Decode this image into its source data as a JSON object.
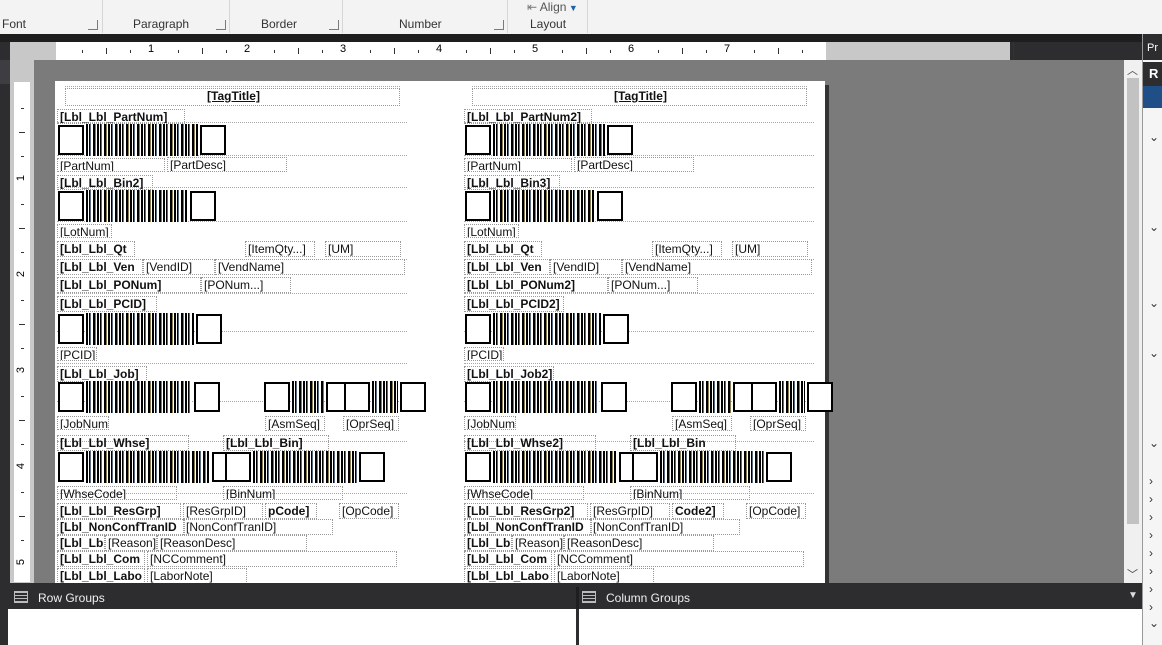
{
  "ribbon": {
    "groups": [
      "Font",
      "Paragraph",
      "Border",
      "Number",
      "Layout"
    ],
    "align_label": "Align"
  },
  "ruler": {
    "h_numbers": [
      "1",
      "2",
      "3",
      "4",
      "5",
      "6",
      "7"
    ],
    "v_numbers": [
      "1",
      "2",
      "3",
      "4",
      "5"
    ]
  },
  "report": {
    "left": {
      "tag_title": "[TagTitle]",
      "part_num_label": "[Lbl_Lbl_PartNum]",
      "part_num": "[PartNum]",
      "part_desc": "[PartDesc]",
      "bin_label": "[Lbl_Lbl_Bin2]",
      "lot_num": "[LotNum]",
      "qty_label": "[Lbl_Lbl_Qt",
      "item_qty": "[ItemQty...]",
      "um": "[UM]",
      "vend_label": "[Lbl_Lbl_Ven",
      "vend_id": "[VendID]",
      "vend_name": "[VendName]",
      "ponum_label": "[Lbl_Lbl_PONum]",
      "ponum": "[PONum...]",
      "pcid_label": "[Lbl_Lbl_PCID]",
      "pcid": "[PCID]",
      "job_label": "[Lbl_Lbl_Job]",
      "job_num": "[JobNum]",
      "asm_seq": "[AsmSeq]",
      "opr_seq": "[OprSeq]",
      "whse_label": "[Lbl_Lbl_Whse]",
      "bin2_label": "[Lbl_Lbl_Bin]",
      "whse_code": "[WhseCode]",
      "bin_num": "[BinNum]",
      "resgrp_label": "[Lbl_Lbl_ResGrp]",
      "resgrp_id": "[ResGrpID]",
      "pcode": "pCode]",
      "opcode": "[OpCode]",
      "nonconf_label": "[Lbl_NonConfTranID",
      "nonconf_id": "[NonConfTranID]",
      "reason_label": "[Lbl_Lbl",
      "reason": "[Reason]",
      "reason_desc": "[ReasonDesc]",
      "comment_label": "[Lbl_Lbl_Com",
      "nc_comment": "[NCComment]",
      "labor_label": "[Lbl_Lbl_Labo",
      "labor_note": "[LaborNote]"
    },
    "right": {
      "tag_title": "[TagTitle]",
      "part_num_label": "[Lbl_Lbl_PartNum2]",
      "part_num": "[PartNum]",
      "part_desc": "[PartDesc]",
      "bin_label": "[Lbl_Lbl_Bin3]",
      "lot_num": "[LotNum]",
      "qty_label": "[Lbl_Lbl_Qt",
      "item_qty": "[ItemQty...]",
      "um": "[UM]",
      "vend_label": "[Lbl_Lbl_Ven",
      "vend_id": "[VendID]",
      "vend_name": "[VendName]",
      "ponum_label": "[Lbl_Lbl_PONum2]",
      "ponum": "[PONum...]",
      "pcid_label": "[Lbl_Lbl_PCID2]",
      "pcid": "[PCID]",
      "job_label": "[Lbl_Lbl_Job2]",
      "job_num": "[JobNum]",
      "asm_seq": "[AsmSeq]",
      "opr_seq": "[OprSeq]",
      "whse_label": "[Lbl_Lbl_Whse2]",
      "bin2_label": "[Lbl_Lbl_Bin",
      "whse_code": "[WhseCode]",
      "bin_num": "[BinNum]",
      "resgrp_label": "[Lbl_Lbl_ResGrp2]",
      "resgrp_id": "[ResGrpID]",
      "pcode": "Code2]",
      "opcode": "[OpCode]",
      "nonconf_label": "[Lbl_NonConfTranID",
      "nonconf_id": "[NonConfTranID]",
      "reason_label": "[Lbl_Lbl",
      "reason": "[Reason]",
      "reason_desc": "[ReasonDesc]",
      "comment_label": "[Lbl_Lbl_Com",
      "nc_comment": "[NCComment]",
      "labor_label": "[Lbl_Lbl_Labo",
      "labor_note": "[LaborNote]"
    }
  },
  "right_panel": {
    "header1": "Pr",
    "header2": "R"
  },
  "bottom": {
    "row_groups": "Row Groups",
    "column_groups": "Column Groups"
  }
}
